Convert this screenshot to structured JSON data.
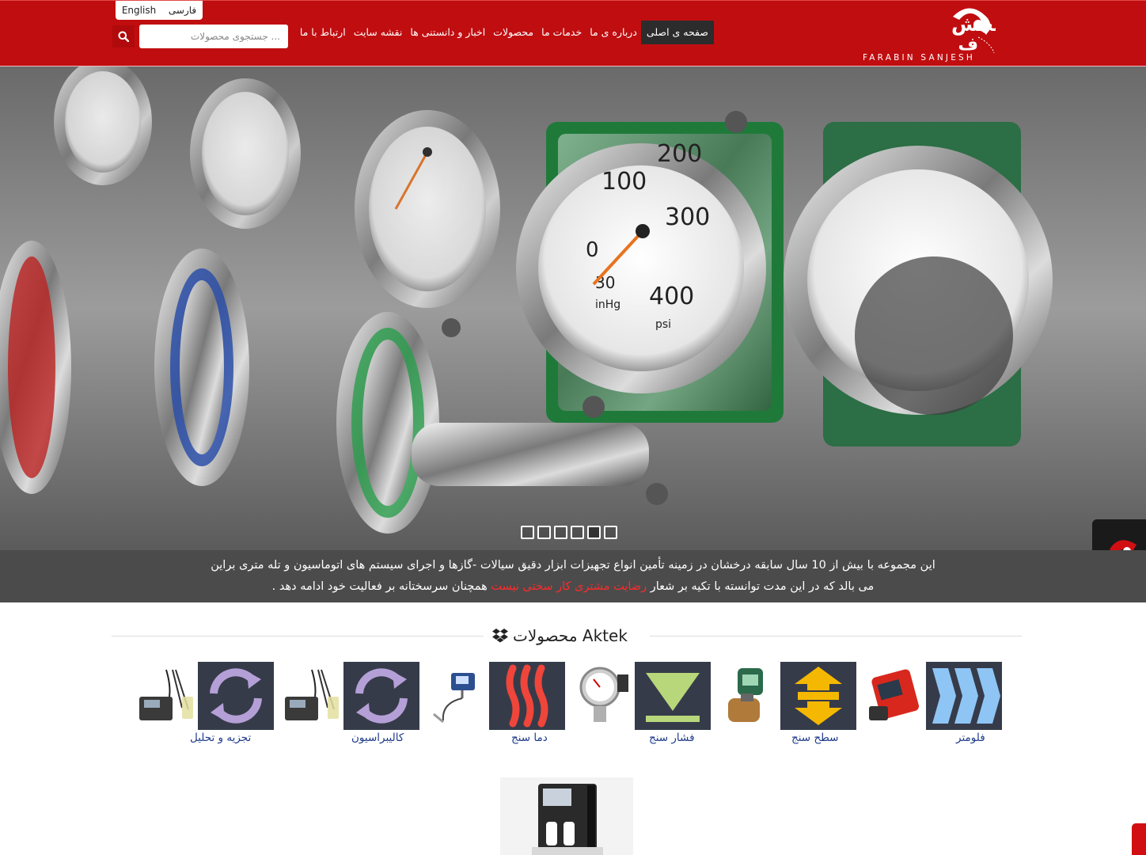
{
  "header": {
    "languages": [
      "English",
      "فارسی"
    ],
    "search": {
      "placeholder": "... جستجوی محصولات"
    },
    "nav": [
      {
        "label": "صفحه ی اصلی",
        "active": true
      },
      {
        "label": "درباره ی ما"
      },
      {
        "label": "خدمات ما"
      },
      {
        "label": "محصولات"
      },
      {
        "label": "اخبار و دانستنی ها"
      },
      {
        "label": "نقشه سایت"
      },
      {
        "label": "ارتباط با ما"
      }
    ],
    "logo": {
      "text_fa": "فرابین سنجش",
      "text_en": "FARABIN SANJESH"
    }
  },
  "hero": {
    "slide_count": 6,
    "active_slide": 5
  },
  "intro": {
    "line1": "این مجموعه با بیش از 10 سال سابقه درخشان در زمینه تأمین انواع تجهیزات ابزار دقیق سیالات -گازها و اجرای سیستم های اتوماسیون و تله متری براین",
    "line2_before": "می بالد که در این مدت توانسته با تکیه بر شعار",
    "line2_highlight": "رضایت مشتری کار سختی نیست",
    "line2_after": "همچنان سرسختانه بر فعالیت خود ادامه دهد ."
  },
  "products": {
    "title": "محصولات Aktek",
    "icon": "dropbox-icon",
    "categories": [
      {
        "label": "فلومتر",
        "icon": "flow-chevrons-icon",
        "color": "#8ec5f5"
      },
      {
        "label": "سطح سنج",
        "icon": "level-arrows-icon",
        "color": "#f5b800"
      },
      {
        "label": "فشار سنج",
        "icon": "pressure-triangle-icon",
        "color": "#b7d77a"
      },
      {
        "label": "دما سنج",
        "icon": "temperature-waves-icon",
        "color": "#f0453a"
      },
      {
        "label": "کالیبراسیون",
        "icon": "calibration-cycle-icon",
        "color": "#b4a0d6"
      },
      {
        "label": "تجزیه و تحلیل",
        "icon": "analysis-cycle-icon",
        "color": "#b4a0d6"
      }
    ]
  },
  "colors": {
    "brand_red": "#c00d10",
    "tile_bg": "#363b4a",
    "intro_bg": "#4b4b4b",
    "highlight": "#ff2a2a",
    "link": "#1e3a8a"
  }
}
